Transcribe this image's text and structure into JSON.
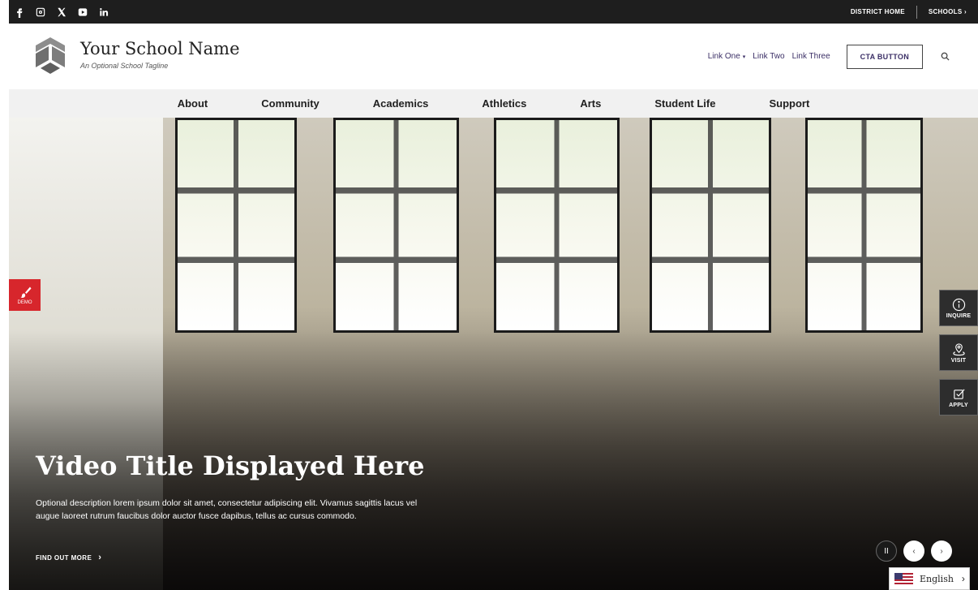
{
  "topbar": {
    "social": [
      {
        "name": "facebook-icon",
        "glyph": "f"
      },
      {
        "name": "instagram-icon",
        "glyph": "◎"
      },
      {
        "name": "x-icon",
        "glyph": "X"
      },
      {
        "name": "youtube-icon",
        "glyph": "▶"
      },
      {
        "name": "linkedin-icon",
        "glyph": "in"
      }
    ],
    "district_home": "DISTRICT HOME",
    "schools": "SCHOOLS ›"
  },
  "header": {
    "school_name": "Your School Name",
    "tagline": "An Optional School Tagline",
    "links": [
      "Link One",
      "Link Two",
      "Link Three"
    ],
    "link_one_caret": "▾",
    "cta_label": "CTA BUTTON"
  },
  "nav": {
    "items": [
      "About",
      "Community",
      "Academics",
      "Athletics",
      "Arts",
      "Student Life",
      "Support"
    ]
  },
  "hero": {
    "title": "Video Title Displayed Here",
    "description": "Optional description lorem ipsum dolor sit amet, consectetur adipiscing elit. Vivamus sagittis lacus vel augue laoreet rutrum faucibus dolor auctor fusce dapibus, tellus ac cursus commodo.",
    "cta": "FIND OUT MORE",
    "cta_chevron": "›"
  },
  "demo": {
    "label": "DEMO"
  },
  "quick_links": {
    "inquire": "INQUIRE",
    "visit": "VISIT",
    "apply": "APPLY"
  },
  "slider": {
    "pause": "II",
    "prev": "‹",
    "next": "›"
  },
  "language": {
    "label": "English",
    "chevron": "›"
  },
  "colors": {
    "accent_red": "#d7262c",
    "link_purple": "#3b2f66",
    "topbar": "#1e1e1e"
  }
}
